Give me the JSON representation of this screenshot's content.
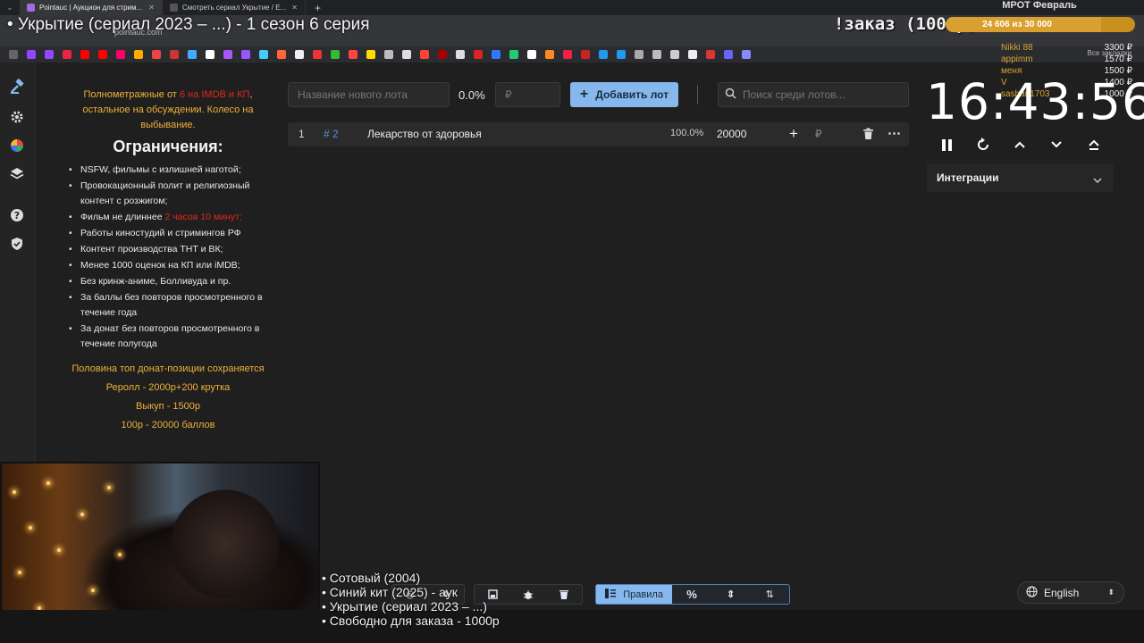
{
  "browser": {
    "tabs": [
      {
        "label": "Pointauc | Аукцион для стрим...",
        "active": true
      },
      {
        "label": "Смотреть сериал Укрытие / Е...",
        "active": false
      }
    ],
    "url": "pointauc.com",
    "all_bookmarks": "Все закладки"
  },
  "overlay": {
    "title": "• Укрытие (сериал 2023 – ...) - 1 сезон 6 серия",
    "order_label": "!заказ (1000р)",
    "mrot_title": "МРОТ Февраль",
    "mrot_progress": "24 606 из 30 000",
    "mrot_fraction": 0.82,
    "donors": [
      "Nikki 88",
      "appimm",
      "меня",
      "V",
      "sashan1703"
    ],
    "donor_amounts": [
      "3300 ₽",
      "1570 ₽",
      "1500 ₽",
      "1400 ₽",
      "1000 ₽"
    ],
    "queue": [
      "Сотовый (2004)",
      "Синий кит (2025) - аук",
      "Укрытие (сериал 2023 – ...)",
      "Свободно для заказа - 1000р"
    ]
  },
  "rules": {
    "intro_a": "Полнометражные от ",
    "intro_red": "6 на IMDB и КП",
    "intro_b": ", остальное на обсуждении. Колесо на выбывание.",
    "limits_title": "Ограничения:",
    "limits": [
      "NSFW, фильмы с излишней наготой;",
      "Провокационный полит и религиозный контент с розжигом;",
      "Фильм не длиннее ",
      "Работы киностудий и стримингов РФ",
      "Контент производства ТНТ и ВК;",
      "Менее 1000 оценок на КП или iMDB;",
      "Без кринж-аниме, Болливуда и пр.",
      "За баллы без повторов просмотренного в течение года",
      "За донат без повторов просмотренного в течение полугода"
    ],
    "limit_duration_red": "2 часов 10 минут;",
    "footer": [
      "Половина топ донат-позиции сохраняется",
      "Реролл - 2000р+200 крутка",
      "Выкуп - 1500р",
      "100р - 20000 баллов"
    ]
  },
  "lot_form": {
    "name_placeholder": "Название нового лота",
    "percent_total": "0.0%",
    "amount_placeholder": "₽",
    "add_button": "Добавить лот",
    "search_placeholder": "Поиск среди лотов..."
  },
  "lots": [
    {
      "index": "1",
      "id": "# 2",
      "name": "Лекарство от здоровья",
      "percent": "100.0%",
      "amount": "20000",
      "currency": "₽"
    }
  ],
  "timer": {
    "time": "16:43:56"
  },
  "integrations": {
    "label": "Интеграции"
  },
  "toolbar": {
    "rules_label": "Правила"
  },
  "language": {
    "value": "English"
  }
}
